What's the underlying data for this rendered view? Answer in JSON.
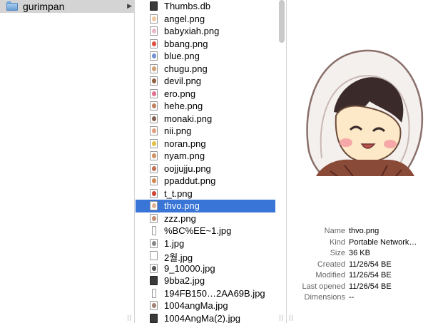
{
  "column1": {
    "folder": {
      "label": "gurimpan"
    }
  },
  "files": [
    {
      "name": "Thumbs.db",
      "kind": "dark"
    },
    {
      "name": "angel.png",
      "color": "#f0c8a0"
    },
    {
      "name": "babyxiah.png",
      "color": "#e8b8c8"
    },
    {
      "name": "bbang.png",
      "color": "#e05040"
    },
    {
      "name": "blue.png",
      "color": "#7090d0"
    },
    {
      "name": "chugu.png",
      "color": "#d0a070"
    },
    {
      "name": "devil.png",
      "color": "#906040"
    },
    {
      "name": "ero.png",
      "color": "#e07090"
    },
    {
      "name": "hehe.png",
      "color": "#c08060"
    },
    {
      "name": "monaki.png",
      "color": "#806050"
    },
    {
      "name": "nii.png",
      "color": "#e0a080"
    },
    {
      "name": "noran.png",
      "color": "#e0c040"
    },
    {
      "name": "nyam.png",
      "color": "#d09060"
    },
    {
      "name": "oojjujju.png",
      "color": "#c07050"
    },
    {
      "name": "ppaddut.png",
      "color": "#d08850"
    },
    {
      "name": "t_t.png",
      "color": "#d04030"
    },
    {
      "name": "thvo.png",
      "color": "#e0b090",
      "selected": true
    },
    {
      "name": "zzz.png",
      "color": "#c09070"
    },
    {
      "name": "%BC%EE~1.jpg",
      "kind": "thin"
    },
    {
      "name": "1.jpg",
      "color": "#888"
    },
    {
      "name": "2월.jpg",
      "kind": "blank"
    },
    {
      "name": "9_10000.jpg",
      "color": "#555"
    },
    {
      "name": "9bba2.jpg",
      "kind": "dark"
    },
    {
      "name": "194FB150…2AA69B.jpg",
      "kind": "thin"
    },
    {
      "name": "1004angMa.jpg",
      "color": "#a08070"
    },
    {
      "name": "1004AngMa(2).jpg",
      "kind": "dark"
    }
  ],
  "info": {
    "rows": [
      {
        "key": "Name",
        "value": "thvo.png"
      },
      {
        "key": "Kind",
        "value": "Portable Network…"
      },
      {
        "key": "Size",
        "value": "36 KB"
      },
      {
        "key": "Created",
        "value": "11/26/54 BE"
      },
      {
        "key": "Modified",
        "value": "11/26/54 BE"
      },
      {
        "key": "Last opened",
        "value": "11/26/54 BE"
      },
      {
        "key": "Dimensions",
        "value": "--"
      }
    ]
  },
  "icons": {
    "folder": "folder-icon",
    "disclosure": "disclosure-triangle-icon",
    "file": "file-icon"
  },
  "colors": {
    "selection": "#3875d7",
    "folder_highlight": "#d4d4d4"
  }
}
